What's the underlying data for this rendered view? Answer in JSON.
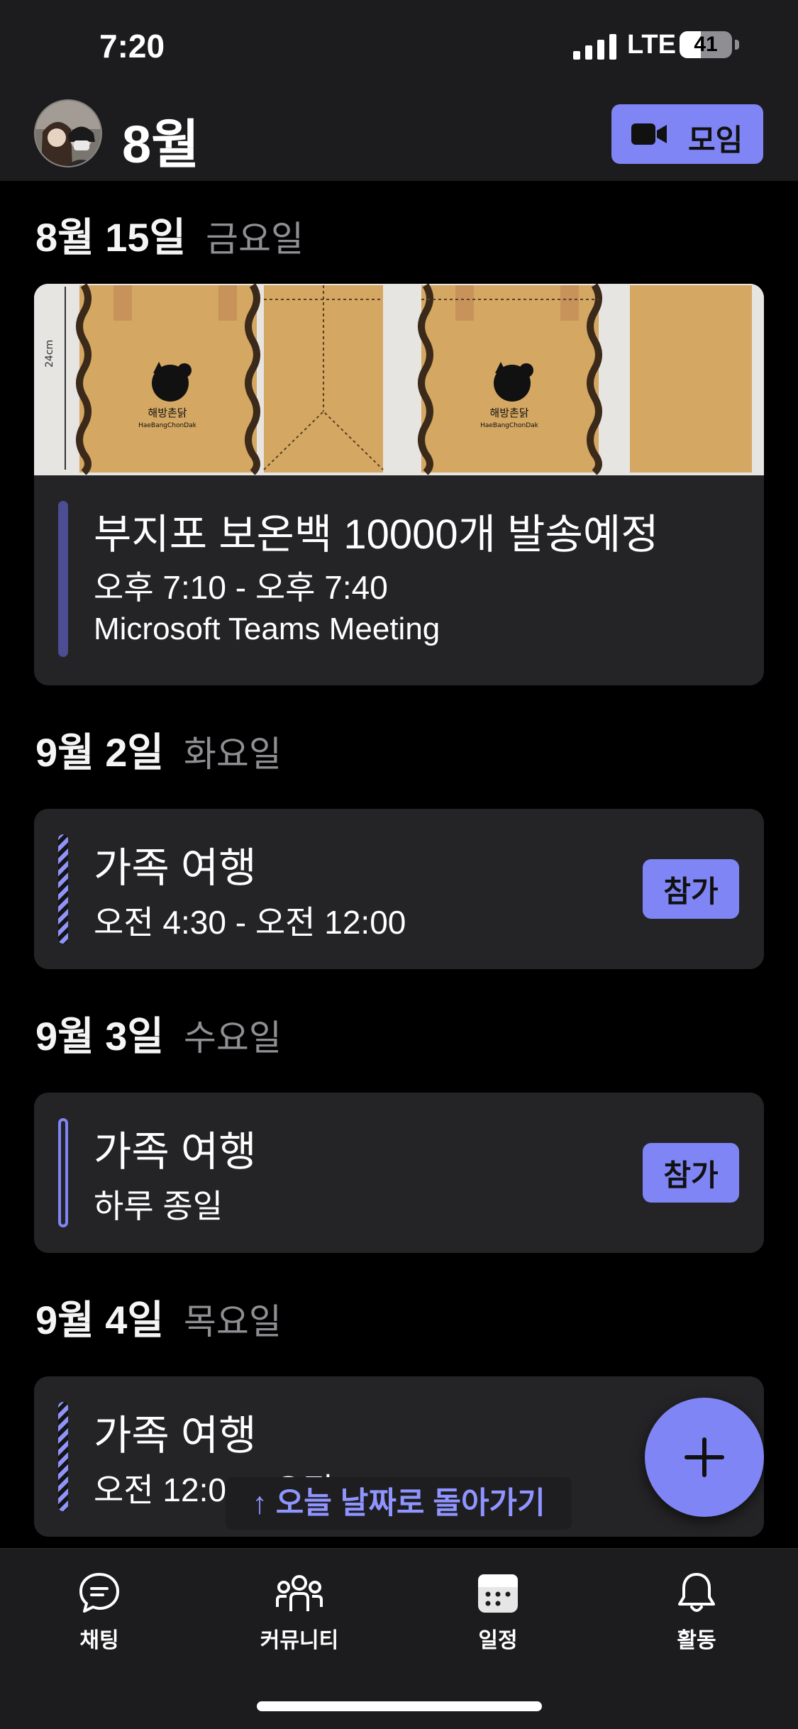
{
  "status_bar": {
    "time": "7:20",
    "network": "LTE",
    "battery": "41",
    "battery_level": 0.41
  },
  "header": {
    "title": "8월",
    "meet_button": "모임"
  },
  "days": [
    {
      "date": "8월 15일",
      "weekday": "금요일",
      "event": {
        "title": "부지포 보온백 10000개 발송예정",
        "time": "오후 7:10 - 오후 7:40",
        "location": "Microsoft Teams Meeting"
      },
      "image": {
        "dimension": "24cm",
        "brand_ko": "해방촌닭",
        "brand_en": "HaeBangChonDak"
      }
    },
    {
      "date": "9월 2일",
      "weekday": "화요일",
      "event": {
        "title": "가족 여행",
        "time": "오전 4:30 - 오전 12:00",
        "join": "참가"
      }
    },
    {
      "date": "9월 3일",
      "weekday": "수요일",
      "event": {
        "title": "가족 여행",
        "time": "하루 종일",
        "join": "참가"
      }
    },
    {
      "date": "9월 4일",
      "weekday": "목요일",
      "event": {
        "title": "가족 여행",
        "time": "오전 12:00 - 오전 5:00"
      }
    }
  ],
  "back_to_today": "↑ 오늘 날짜로 돌아가기",
  "tabs": [
    {
      "label": "채팅",
      "icon": "chat-icon"
    },
    {
      "label": "커뮤니티",
      "icon": "community-icon"
    },
    {
      "label": "일정",
      "icon": "calendar-icon"
    },
    {
      "label": "활동",
      "icon": "bell-icon"
    }
  ],
  "colors": {
    "accent": "#7f85f5",
    "card": "#242426",
    "header": "#1c1c1e"
  }
}
